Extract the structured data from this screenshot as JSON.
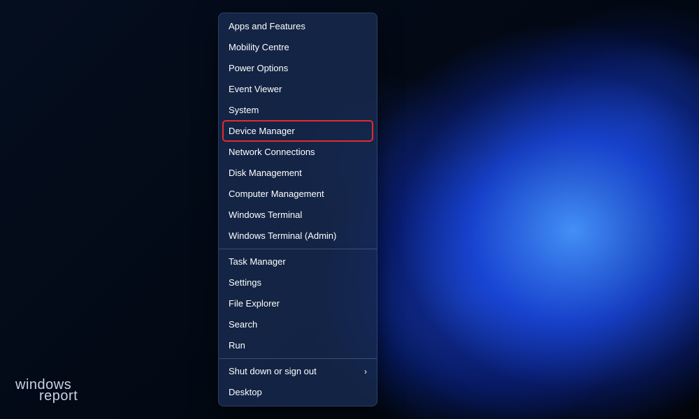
{
  "menu": {
    "groups": [
      [
        {
          "id": "apps-and-features",
          "label": "Apps and Features",
          "submenu": false
        },
        {
          "id": "mobility-centre",
          "label": "Mobility Centre",
          "submenu": false
        },
        {
          "id": "power-options",
          "label": "Power Options",
          "submenu": false
        },
        {
          "id": "event-viewer",
          "label": "Event Viewer",
          "submenu": false
        },
        {
          "id": "system",
          "label": "System",
          "submenu": false
        },
        {
          "id": "device-manager",
          "label": "Device Manager",
          "submenu": false,
          "highlighted": true
        },
        {
          "id": "network-connections",
          "label": "Network Connections",
          "submenu": false
        },
        {
          "id": "disk-management",
          "label": "Disk Management",
          "submenu": false
        },
        {
          "id": "computer-management",
          "label": "Computer Management",
          "submenu": false
        },
        {
          "id": "windows-terminal",
          "label": "Windows Terminal",
          "submenu": false
        },
        {
          "id": "windows-terminal-admin",
          "label": "Windows Terminal (Admin)",
          "submenu": false
        }
      ],
      [
        {
          "id": "task-manager",
          "label": "Task Manager",
          "submenu": false
        },
        {
          "id": "settings",
          "label": "Settings",
          "submenu": false
        },
        {
          "id": "file-explorer",
          "label": "File Explorer",
          "submenu": false
        },
        {
          "id": "search",
          "label": "Search",
          "submenu": false
        },
        {
          "id": "run",
          "label": "Run",
          "submenu": false
        }
      ],
      [
        {
          "id": "shut-down-or-sign-out",
          "label": "Shut down or sign out",
          "submenu": true
        },
        {
          "id": "desktop",
          "label": "Desktop",
          "submenu": false
        }
      ]
    ],
    "chevron_glyph": "›"
  },
  "highlight_color": "#e12c2c",
  "watermark": {
    "line1": "windows",
    "line2": "report"
  }
}
